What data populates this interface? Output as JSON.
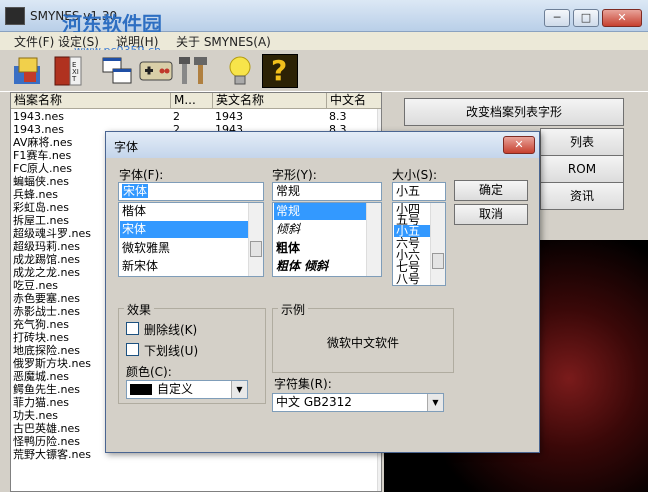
{
  "window": {
    "title": "SMYNES v1.30",
    "watermark": "河东软件园",
    "watermark_url": "www.pc0359.cn",
    "buttons": [
      "─",
      "□",
      "✕"
    ]
  },
  "menu": {
    "items": [
      "文件(F)",
      "设定(S)",
      "说明(H)",
      "关于 SMYNES(A)"
    ]
  },
  "toolbar": {
    "exit_label": "EXIT",
    "help_label": "?"
  },
  "file_list": {
    "columns": [
      "档案名称",
      "M...",
      "英文名称",
      "中文名"
    ],
    "rows": [
      [
        "1943.nes",
        "2",
        "1943",
        "8.3"
      ],
      [
        "1943.nes",
        "2",
        "1943",
        "8.3"
      ],
      [
        "AV麻将.nes",
        "",
        "",
        ""
      ],
      [
        "F1赛车.nes",
        "",
        "",
        ""
      ],
      [
        "FC原人.nes",
        "",
        "",
        ""
      ],
      [
        "蝙蝠侠.nes",
        "",
        "",
        ""
      ],
      [
        "兵蜂.nes",
        "",
        "",
        ""
      ],
      [
        "彩虹岛.nes",
        "",
        "",
        ""
      ],
      [
        "拆屋工.nes",
        "",
        "",
        ""
      ],
      [
        "超级魂斗罗.nes",
        "",
        "",
        ""
      ],
      [
        "超级玛莉.nes",
        "",
        "",
        ""
      ],
      [
        "成龙踢馆.nes",
        "",
        "",
        ""
      ],
      [
        "成龙之龙.nes",
        "",
        "",
        ""
      ],
      [
        "吃豆.nes",
        "",
        "",
        ""
      ],
      [
        "赤色要塞.nes",
        "",
        "",
        ""
      ],
      [
        "赤影战士.nes",
        "",
        "",
        ""
      ],
      [
        "充气狗.nes",
        "",
        "",
        ""
      ],
      [
        "打砖块.nes",
        "",
        "",
        ""
      ],
      [
        "地底探险.nes",
        "",
        "",
        ""
      ],
      [
        "俄罗斯方块.nes",
        "",
        "",
        ""
      ],
      [
        "恶魔城.nes",
        "",
        "",
        ""
      ],
      [
        "鳄鱼先生.nes",
        "",
        "",
        ""
      ],
      [
        "菲力猫.nes",
        "",
        "",
        ""
      ],
      [
        "功夫.nes",
        "",
        "",
        ""
      ],
      [
        "古巴英雄.nes",
        "",
        "",
        ""
      ],
      [
        "怪鸭历险.nes",
        "",
        "",
        ""
      ],
      [
        "荒野大镖客.nes",
        "",
        "",
        ""
      ]
    ]
  },
  "right_panel": {
    "buttons": [
      "改变档案列表字形",
      "列表",
      "ROM",
      "资讯"
    ]
  },
  "font_dialog": {
    "title": "字体",
    "close": "✕",
    "font_label": "字体(F):",
    "font_value": "宋体",
    "font_items": [
      "楷体",
      "宋体",
      "微软雅黑",
      "新宋体"
    ],
    "style_label": "字形(Y):",
    "style_value": "常规",
    "style_items": [
      "常规",
      "倾斜",
      "粗体",
      "粗体 倾斜"
    ],
    "size_label": "大小(S):",
    "size_value": "小五",
    "size_items": [
      "小四",
      "五号",
      "小五",
      "六号",
      "小六",
      "七号",
      "八号"
    ],
    "ok": "确定",
    "cancel": "取消",
    "effects_label": "效果",
    "strikeout": "删除线(K)",
    "underline": "下划线(U)",
    "color_label": "颜色(C):",
    "color_value": "自定义",
    "color_swatch": "#000000",
    "sample_label": "示例",
    "sample_text": "微软中文软件",
    "charset_label": "字符集(R):",
    "charset_value": "中文 GB2312"
  }
}
